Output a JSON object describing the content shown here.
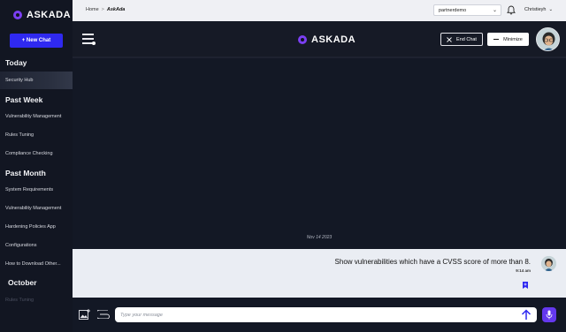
{
  "brand": {
    "name": "ASKADA",
    "accent": "#7b3ff2"
  },
  "sidebar": {
    "new_chat_label": "+ New Chat",
    "sections": [
      {
        "title": "Today",
        "items": [
          {
            "label": "Security Hub",
            "active": true
          }
        ]
      },
      {
        "title": "Past Week",
        "items": [
          {
            "label": "Vulnerability Management"
          },
          {
            "label": "Rules Tuning"
          },
          {
            "label": "Compliance Checking"
          }
        ]
      },
      {
        "title": "Past Month",
        "items": [
          {
            "label": "System Requirements"
          },
          {
            "label": "Vulnerability Management"
          },
          {
            "label": "Hardening Policies App"
          },
          {
            "label": "Configurations"
          },
          {
            "label": "How to Download Other..."
          }
        ]
      },
      {
        "title": "October",
        "items": [
          {
            "label": "Rules Tuning",
            "faded": true
          }
        ]
      }
    ]
  },
  "topbar": {
    "breadcrumb": {
      "home": "Home",
      "separator": ">",
      "current": "AskAda"
    },
    "workspace": "partnerdemo",
    "user": "Christieyh",
    "icons": {
      "bell": "bell-icon",
      "chevron": "chevron-down-icon"
    }
  },
  "chat_header": {
    "title": "ASKADA",
    "end_chat_label": "End Chat",
    "minimize_label": "Minimize"
  },
  "conversation": {
    "date": "Nov 14 2023",
    "messages": [
      {
        "text": "Show vulnerabilities which have a CVSS score of more than 8.",
        "time": "9:14 am"
      }
    ]
  },
  "composer": {
    "placeholder": "Type your message"
  },
  "colors": {
    "primary_button": "#2f29f0",
    "mic": "#6438ee",
    "send": "#2f29f0",
    "bookmark": "#2f29f0"
  }
}
